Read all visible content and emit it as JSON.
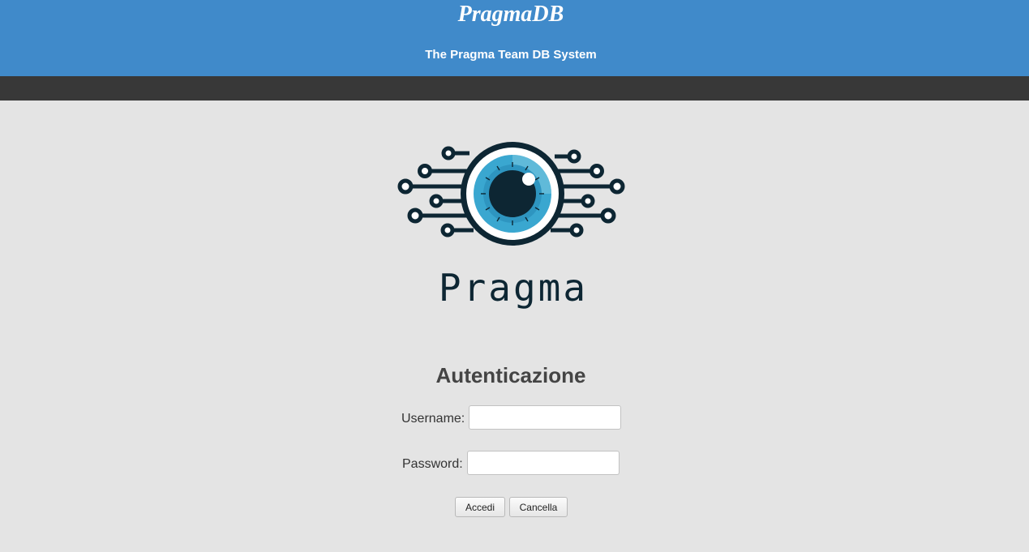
{
  "header": {
    "title": "PragmaDB",
    "subtitle": "The Pragma Team DB System"
  },
  "logo": {
    "icon": "eye-circuit-icon",
    "text": "Pragma"
  },
  "login": {
    "title": "Autenticazione",
    "username_label": "Username:",
    "username_value": "",
    "password_label": "Password:",
    "password_value": "",
    "submit_label": "Accedi",
    "reset_label": "Cancella"
  },
  "colors": {
    "header_bg": "#408aca",
    "navbar_bg": "#383838",
    "page_bg": "#e4e4e4",
    "logo_dark": "#0d2633",
    "logo_iris": "#3aa7d0"
  }
}
